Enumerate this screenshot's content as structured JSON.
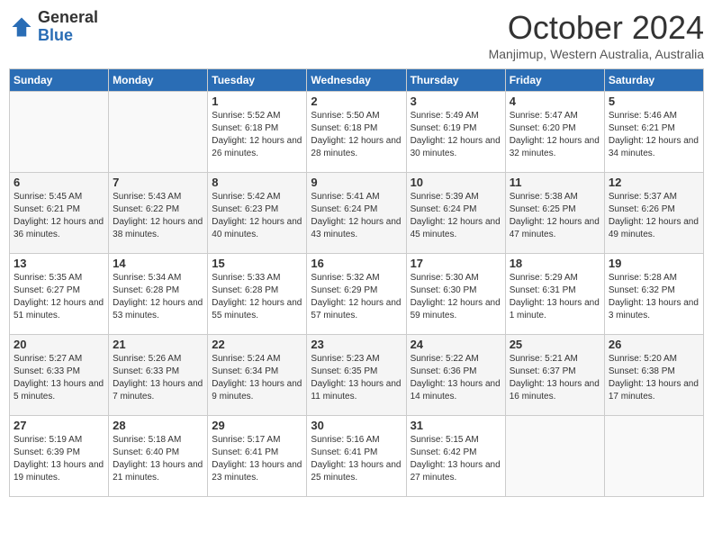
{
  "header": {
    "logo_line1": "General",
    "logo_line2": "Blue",
    "month_title": "October 2024",
    "subtitle": "Manjimup, Western Australia, Australia"
  },
  "days_of_week": [
    "Sunday",
    "Monday",
    "Tuesday",
    "Wednesday",
    "Thursday",
    "Friday",
    "Saturday"
  ],
  "weeks": [
    [
      {
        "day": "",
        "content": ""
      },
      {
        "day": "",
        "content": ""
      },
      {
        "day": "1",
        "content": "Sunrise: 5:52 AM\nSunset: 6:18 PM\nDaylight: 12 hours and 26 minutes."
      },
      {
        "day": "2",
        "content": "Sunrise: 5:50 AM\nSunset: 6:18 PM\nDaylight: 12 hours and 28 minutes."
      },
      {
        "day": "3",
        "content": "Sunrise: 5:49 AM\nSunset: 6:19 PM\nDaylight: 12 hours and 30 minutes."
      },
      {
        "day": "4",
        "content": "Sunrise: 5:47 AM\nSunset: 6:20 PM\nDaylight: 12 hours and 32 minutes."
      },
      {
        "day": "5",
        "content": "Sunrise: 5:46 AM\nSunset: 6:21 PM\nDaylight: 12 hours and 34 minutes."
      }
    ],
    [
      {
        "day": "6",
        "content": "Sunrise: 5:45 AM\nSunset: 6:21 PM\nDaylight: 12 hours and 36 minutes."
      },
      {
        "day": "7",
        "content": "Sunrise: 5:43 AM\nSunset: 6:22 PM\nDaylight: 12 hours and 38 minutes."
      },
      {
        "day": "8",
        "content": "Sunrise: 5:42 AM\nSunset: 6:23 PM\nDaylight: 12 hours and 40 minutes."
      },
      {
        "day": "9",
        "content": "Sunrise: 5:41 AM\nSunset: 6:24 PM\nDaylight: 12 hours and 43 minutes."
      },
      {
        "day": "10",
        "content": "Sunrise: 5:39 AM\nSunset: 6:24 PM\nDaylight: 12 hours and 45 minutes."
      },
      {
        "day": "11",
        "content": "Sunrise: 5:38 AM\nSunset: 6:25 PM\nDaylight: 12 hours and 47 minutes."
      },
      {
        "day": "12",
        "content": "Sunrise: 5:37 AM\nSunset: 6:26 PM\nDaylight: 12 hours and 49 minutes."
      }
    ],
    [
      {
        "day": "13",
        "content": "Sunrise: 5:35 AM\nSunset: 6:27 PM\nDaylight: 12 hours and 51 minutes."
      },
      {
        "day": "14",
        "content": "Sunrise: 5:34 AM\nSunset: 6:28 PM\nDaylight: 12 hours and 53 minutes."
      },
      {
        "day": "15",
        "content": "Sunrise: 5:33 AM\nSunset: 6:28 PM\nDaylight: 12 hours and 55 minutes."
      },
      {
        "day": "16",
        "content": "Sunrise: 5:32 AM\nSunset: 6:29 PM\nDaylight: 12 hours and 57 minutes."
      },
      {
        "day": "17",
        "content": "Sunrise: 5:30 AM\nSunset: 6:30 PM\nDaylight: 12 hours and 59 minutes."
      },
      {
        "day": "18",
        "content": "Sunrise: 5:29 AM\nSunset: 6:31 PM\nDaylight: 13 hours and 1 minute."
      },
      {
        "day": "19",
        "content": "Sunrise: 5:28 AM\nSunset: 6:32 PM\nDaylight: 13 hours and 3 minutes."
      }
    ],
    [
      {
        "day": "20",
        "content": "Sunrise: 5:27 AM\nSunset: 6:33 PM\nDaylight: 13 hours and 5 minutes."
      },
      {
        "day": "21",
        "content": "Sunrise: 5:26 AM\nSunset: 6:33 PM\nDaylight: 13 hours and 7 minutes."
      },
      {
        "day": "22",
        "content": "Sunrise: 5:24 AM\nSunset: 6:34 PM\nDaylight: 13 hours and 9 minutes."
      },
      {
        "day": "23",
        "content": "Sunrise: 5:23 AM\nSunset: 6:35 PM\nDaylight: 13 hours and 11 minutes."
      },
      {
        "day": "24",
        "content": "Sunrise: 5:22 AM\nSunset: 6:36 PM\nDaylight: 13 hours and 14 minutes."
      },
      {
        "day": "25",
        "content": "Sunrise: 5:21 AM\nSunset: 6:37 PM\nDaylight: 13 hours and 16 minutes."
      },
      {
        "day": "26",
        "content": "Sunrise: 5:20 AM\nSunset: 6:38 PM\nDaylight: 13 hours and 17 minutes."
      }
    ],
    [
      {
        "day": "27",
        "content": "Sunrise: 5:19 AM\nSunset: 6:39 PM\nDaylight: 13 hours and 19 minutes."
      },
      {
        "day": "28",
        "content": "Sunrise: 5:18 AM\nSunset: 6:40 PM\nDaylight: 13 hours and 21 minutes."
      },
      {
        "day": "29",
        "content": "Sunrise: 5:17 AM\nSunset: 6:41 PM\nDaylight: 13 hours and 23 minutes."
      },
      {
        "day": "30",
        "content": "Sunrise: 5:16 AM\nSunset: 6:41 PM\nDaylight: 13 hours and 25 minutes."
      },
      {
        "day": "31",
        "content": "Sunrise: 5:15 AM\nSunset: 6:42 PM\nDaylight: 13 hours and 27 minutes."
      },
      {
        "day": "",
        "content": ""
      },
      {
        "day": "",
        "content": ""
      }
    ]
  ]
}
